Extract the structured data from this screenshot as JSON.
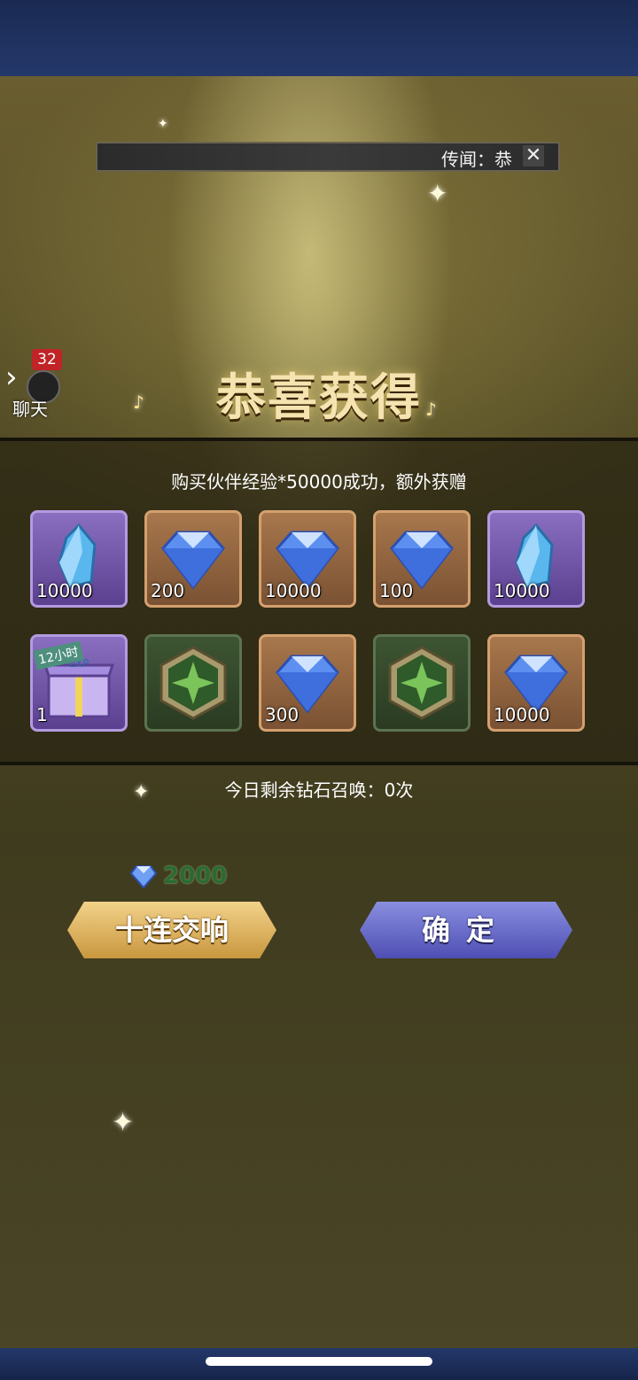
{
  "announcement": {
    "text": "传闻：恭"
  },
  "chat": {
    "badge": "32",
    "label": "聊天"
  },
  "reward_title": "恭喜获得",
  "purchase_message": "购买伙伴经验*50000成功，额外获赠",
  "rewards": [
    {
      "type": "crystal",
      "frame": "purple",
      "qty": "10000"
    },
    {
      "type": "diamond",
      "frame": "bronze",
      "qty": "200"
    },
    {
      "type": "diamond",
      "frame": "bronze",
      "qty": "10000"
    },
    {
      "type": "diamond",
      "frame": "bronze",
      "qty": "100"
    },
    {
      "type": "crystal",
      "frame": "purple",
      "qty": "10000"
    },
    {
      "type": "exp-gift-box",
      "frame": "purple",
      "qty": "1",
      "tag": "12小时"
    },
    {
      "type": "emblem",
      "frame": "green",
      "qty": ""
    },
    {
      "type": "diamond",
      "frame": "bronze",
      "qty": "300"
    },
    {
      "type": "emblem",
      "frame": "green",
      "qty": ""
    },
    {
      "type": "diamond",
      "frame": "bronze",
      "qty": "10000"
    }
  ],
  "summon_remaining": "今日剩余钻石召唤：0次",
  "cost": {
    "icon": "diamond-icon",
    "value": "2000"
  },
  "buttons": {
    "ten_pull": "十连交响",
    "confirm": "确定"
  },
  "colors": {
    "gold": "#c9973f",
    "blue": "#4e4fb3",
    "purple": "#5b4090",
    "bronze": "#7a5233",
    "green": "#2a3b22"
  }
}
